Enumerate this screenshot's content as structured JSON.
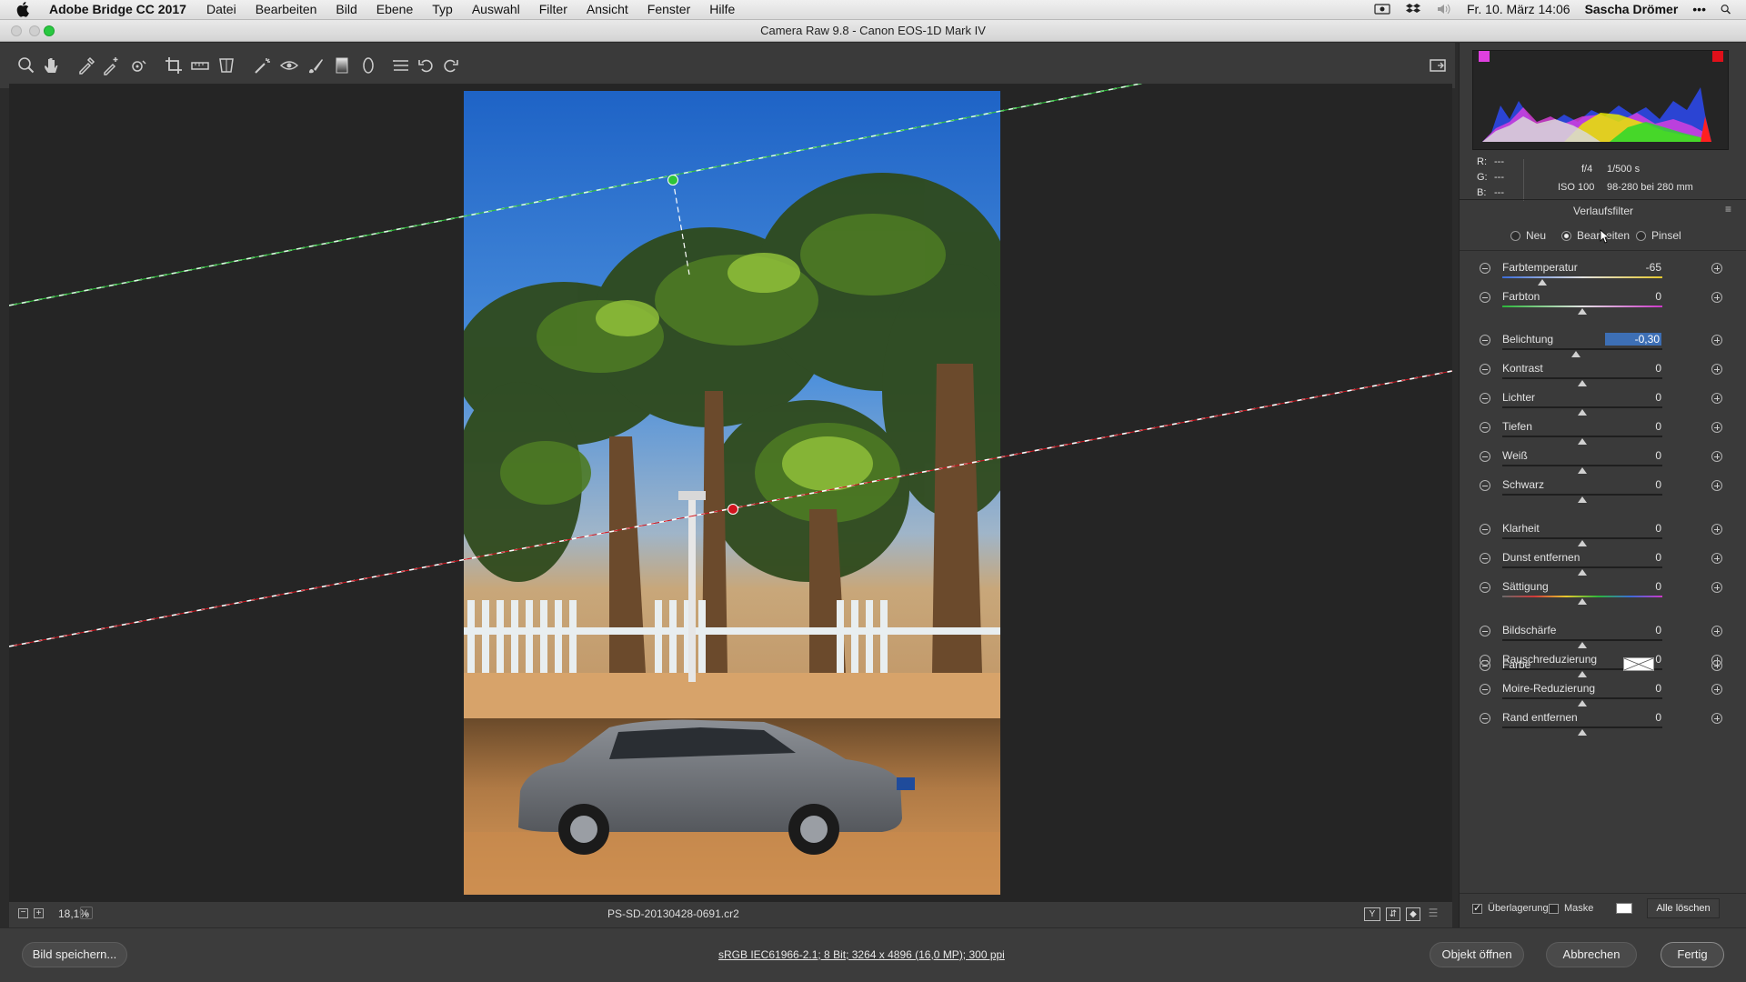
{
  "menubar": {
    "app_name": "Adobe Bridge CC 2017",
    "items": [
      "Datei",
      "Bearbeiten",
      "Bild",
      "Ebene",
      "Typ",
      "Auswahl",
      "Filter",
      "Ansicht",
      "Fenster",
      "Hilfe"
    ],
    "datetime": "Fr. 10. März 14:06",
    "user": "Sascha Drömer",
    "more": "•••"
  },
  "window": {
    "title": "Camera Raw 9.8  -  Canon EOS-1D Mark IV"
  },
  "toolbar": {
    "tools": [
      "zoom-icon",
      "hand-icon",
      "white-balance-icon",
      "color-sampler-icon",
      "target-adjustment-icon",
      "crop-icon",
      "straighten-icon",
      "transform-icon",
      "spot-removal-icon",
      "red-eye-icon",
      "adjustment-brush-icon",
      "graduated-filter-icon",
      "radial-filter-icon",
      "preferences-icon",
      "rotate-left-icon",
      "rotate-right-icon"
    ],
    "fullscreen_icon": "fullscreen-icon"
  },
  "status": {
    "zoom": "18,1%",
    "filename": "PS-SD-20130428-0691.cr2"
  },
  "info": {
    "r_label": "R:",
    "r_value": "---",
    "g_label": "G:",
    "g_value": "---",
    "b_label": "B:",
    "b_value": "---",
    "aperture": "f/4",
    "shutter": "1/500 s",
    "iso": "ISO 100",
    "lens": "98-280 bei 280 mm"
  },
  "panel": {
    "title": "Verlaufsfilter",
    "modes": [
      {
        "label": "Neu",
        "selected": false
      },
      {
        "label": "Bearbeiten",
        "selected": true
      },
      {
        "label": "Pinsel",
        "selected": false
      }
    ],
    "sliders": [
      {
        "label": "Farbtemperatur",
        "value": "-65",
        "position": 0.25,
        "track": "temp"
      },
      {
        "label": "Farbton",
        "value": "0",
        "position": 0.5,
        "track": "tint"
      },
      {
        "label": "Belichtung",
        "value": "-0,30",
        "position": 0.46,
        "track": "plain",
        "selected": true
      },
      {
        "label": "Kontrast",
        "value": "0",
        "position": 0.5,
        "track": "plain"
      },
      {
        "label": "Lichter",
        "value": "0",
        "position": 0.5,
        "track": "plain"
      },
      {
        "label": "Tiefen",
        "value": "0",
        "position": 0.5,
        "track": "plain"
      },
      {
        "label": "Weiß",
        "value": "0",
        "position": 0.5,
        "track": "plain"
      },
      {
        "label": "Schwarz",
        "value": "0",
        "position": 0.5,
        "track": "plain"
      },
      {
        "label": "Klarheit",
        "value": "0",
        "position": 0.5,
        "track": "plain"
      },
      {
        "label": "Dunst entfernen",
        "value": "0",
        "position": 0.5,
        "track": "plain"
      },
      {
        "label": "Sättigung",
        "value": "0",
        "position": 0.5,
        "track": "sat"
      },
      {
        "label": "Bildschärfe",
        "value": "0",
        "position": 0.5,
        "track": "plain"
      },
      {
        "label": "Rauschreduzierung",
        "value": "0",
        "position": 0.5,
        "track": "plain"
      },
      {
        "label": "Moire-Reduzierung",
        "value": "0",
        "position": 0.5,
        "track": "plain"
      },
      {
        "label": "Rand entfernen",
        "value": "0",
        "position": 0.5,
        "track": "plain"
      }
    ],
    "color_label": "Farbe",
    "overlay_label": "Überlagerung",
    "overlay_checked": true,
    "mask_label": "Maske",
    "mask_checked": false,
    "clear_all": "Alle löschen"
  },
  "bottom": {
    "save_image": "Bild speichern...",
    "workflow_link": "sRGB IEC61966-2.1; 8 Bit; 3264 x 4896 (16,0 MP); 300 ppi",
    "open_object": "Objekt öffnen",
    "cancel": "Abbrechen",
    "done": "Fertig"
  },
  "colors": {
    "accent": "#3d6fb5",
    "start_pin": "#2ec43a",
    "end_pin": "#d0141e"
  }
}
